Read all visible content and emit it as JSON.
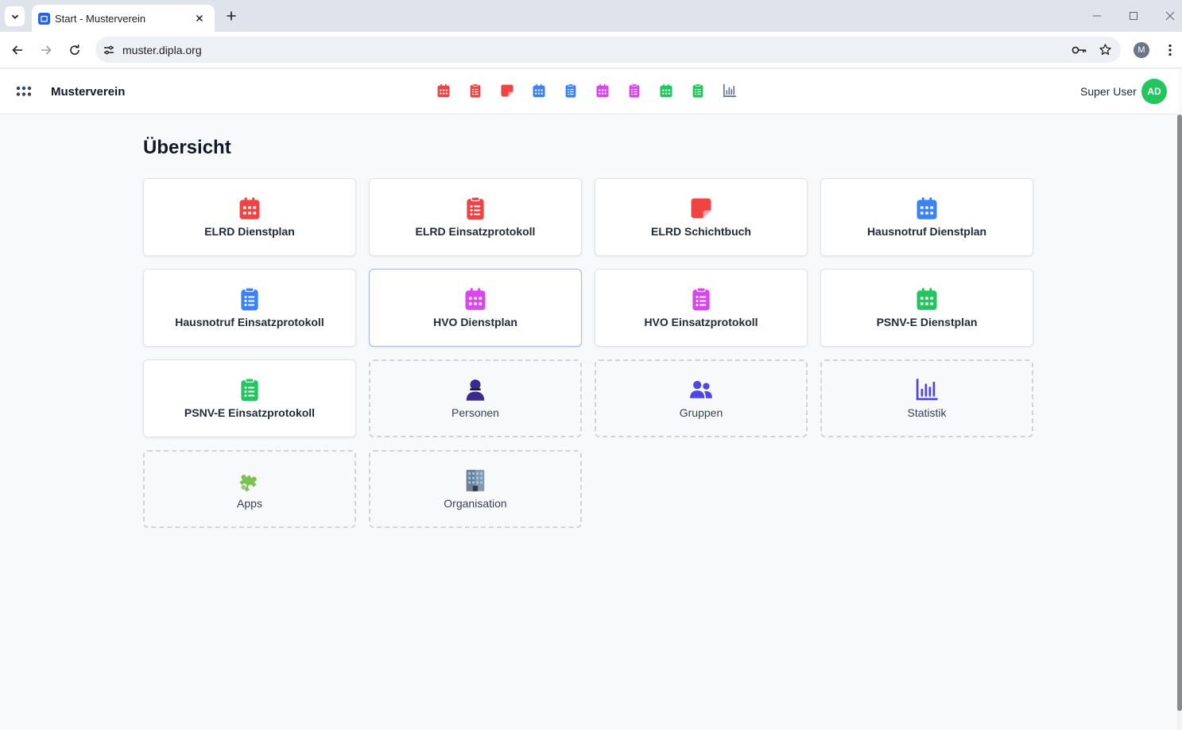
{
  "browser": {
    "tab_title": "Start - Musterverein",
    "url": "muster.dipla.org",
    "profile_initial": "M"
  },
  "header": {
    "org_name": "Musterverein",
    "user_name": "Super User",
    "avatar_initials": "AD",
    "quick_nav": [
      {
        "icon": "calendar-icon",
        "color": "#ef4444"
      },
      {
        "icon": "clipboard-icon",
        "color": "#ef4444"
      },
      {
        "icon": "note-icon",
        "color": "#ef4444"
      },
      {
        "icon": "calendar-icon",
        "color": "#3b82f6"
      },
      {
        "icon": "clipboard-icon",
        "color": "#3b82f6"
      },
      {
        "icon": "calendar-icon",
        "color": "#d946ef"
      },
      {
        "icon": "clipboard-icon",
        "color": "#d946ef"
      },
      {
        "icon": "calendar-icon",
        "color": "#22c55e"
      },
      {
        "icon": "clipboard-icon",
        "color": "#22c55e"
      },
      {
        "icon": "bar-chart-icon",
        "color": "#64748b"
      }
    ]
  },
  "main": {
    "title": "Übersicht",
    "cards": [
      {
        "label": "ELRD Dienstplan",
        "icon": "calendar-icon",
        "color": "#ef4444",
        "type": "app"
      },
      {
        "label": "ELRD Einsatzprotokoll",
        "icon": "clipboard-icon",
        "color": "#ef4444",
        "type": "app"
      },
      {
        "label": "ELRD Schichtbuch",
        "icon": "note-icon",
        "color": "#ef4444",
        "type": "app"
      },
      {
        "label": "Hausnotruf Dienstplan",
        "icon": "calendar-icon",
        "color": "#3b82f6",
        "type": "app"
      },
      {
        "label": "Hausnotruf Einsatzprotokoll",
        "icon": "clipboard-icon",
        "color": "#3b82f6",
        "type": "app"
      },
      {
        "label": "HVO Dienstplan",
        "icon": "calendar-icon",
        "color": "#d946ef",
        "type": "app",
        "hovered": true
      },
      {
        "label": "HVO Einsatzprotokoll",
        "icon": "clipboard-icon",
        "color": "#d946ef",
        "type": "app"
      },
      {
        "label": "PSNV-E Dienstplan",
        "icon": "calendar-icon",
        "color": "#22c55e",
        "type": "app"
      },
      {
        "label": "PSNV-E Einsatzprotokoll",
        "icon": "clipboard-icon",
        "color": "#22c55e",
        "type": "app"
      },
      {
        "label": "Personen",
        "icon": "person-icon",
        "color": "#3b2a8c",
        "type": "admin"
      },
      {
        "label": "Gruppen",
        "icon": "users-icon",
        "color": "#4f46e5",
        "type": "admin"
      },
      {
        "label": "Statistik",
        "icon": "bar-chart-icon",
        "color": "#4f46e5",
        "type": "admin"
      },
      {
        "label": "Apps",
        "icon": "puzzle-icon",
        "color": "#7cc04f",
        "type": "admin"
      },
      {
        "label": "Organisation",
        "icon": "office-building-icon",
        "color": "#5b6b82",
        "type": "admin"
      }
    ]
  }
}
